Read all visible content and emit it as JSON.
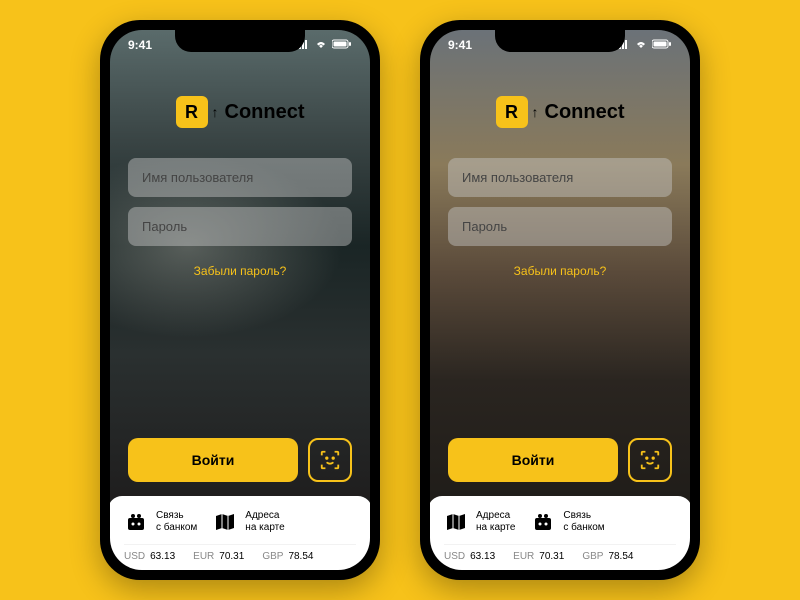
{
  "status": {
    "time": "9:41"
  },
  "app": {
    "logo_letter": "R",
    "name": "Connect"
  },
  "form": {
    "username_placeholder": "Имя пользователя",
    "password_placeholder": "Пароль",
    "forgot_label": "Забыли пароль?",
    "login_label": "Войти"
  },
  "quick_links": {
    "contact_bank": "Связь\nс банком",
    "addresses_map": "Адреса\nна карте"
  },
  "rates": [
    {
      "code": "USD",
      "value": "63.13"
    },
    {
      "code": "EUR",
      "value": "70.31"
    },
    {
      "code": "GBP",
      "value": "78.54"
    }
  ],
  "phones": [
    {
      "quick_order": [
        "contact_bank",
        "addresses_map"
      ]
    },
    {
      "quick_order": [
        "addresses_map",
        "contact_bank"
      ]
    }
  ]
}
